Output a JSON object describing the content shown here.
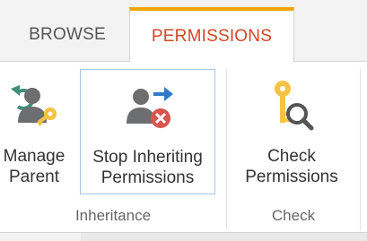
{
  "tabs": [
    {
      "label": "BROWSE",
      "active": false
    },
    {
      "label": "PERMISSIONS",
      "active": true
    }
  ],
  "groups": {
    "inheritance": {
      "label": "Inheritance",
      "buttons": {
        "manage_parent": {
          "line1": "Manage",
          "line2": "Parent",
          "icon": "manage-parent-icon"
        },
        "stop_inheriting": {
          "line1": "Stop Inheriting",
          "line2": "Permissions",
          "icon": "stop-inheriting-icon",
          "selected": true
        }
      }
    },
    "check": {
      "label": "Check",
      "buttons": {
        "check_permissions": {
          "line1": "Check",
          "line2": "Permissions",
          "icon": "key-magnifier-icon"
        }
      }
    }
  },
  "colors": {
    "active_tab_text": "#d24726",
    "active_tab_top": "#f0a30a",
    "selected_border": "#a9c6e3",
    "user_gray": "#6d6e70",
    "key_gold": "#f5c242",
    "arrow_blue": "#2e7cc8",
    "stop_red": "#d9534f",
    "arrow_teal": "#3f8f7a"
  }
}
